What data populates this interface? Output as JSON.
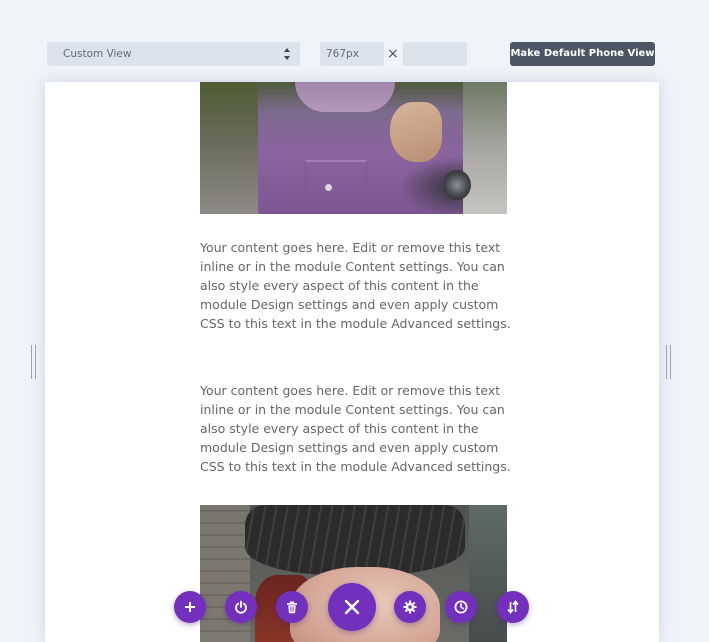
{
  "toolbar": {
    "view_select": {
      "value": "Custom View",
      "arrows_icon": "sort-arrows-icon"
    },
    "width_value": "767px",
    "times_sign": "×",
    "height_value": "",
    "default_view_button": "Make Default Phone View"
  },
  "content": {
    "text_module_1": "Your content goes here. Edit or remove this text inline or in the module Content settings. You can also style every aspect of this content in the module Design settings and even apply custom CSS to this text in the module Advanced settings.",
    "text_module_2": "Your content goes here. Edit or remove this text inline or in the module Content settings. You can also style every aspect of this content in the module Design settings and even apply custom CSS to this text in the module Advanced settings.",
    "image_top": "man-in-purple-shirt-photo",
    "image_bottom": "woman-in-beanie-photo"
  },
  "action_bar": {
    "accent_color": "#7230bd",
    "buttons": [
      {
        "name": "add",
        "icon": "plus-icon"
      },
      {
        "name": "power",
        "icon": "power-icon"
      },
      {
        "name": "delete",
        "icon": "trash-icon"
      },
      {
        "name": "close",
        "icon": "close-icon"
      },
      {
        "name": "settings",
        "icon": "gear-icon"
      },
      {
        "name": "history",
        "icon": "clock-icon"
      },
      {
        "name": "reorder",
        "icon": "sort-arrows-icon"
      }
    ]
  },
  "colors": {
    "page_background": "#f0f3f8",
    "input_background": "#dde3ec",
    "primary_button": "#4c5564",
    "body_text": "#666666"
  }
}
